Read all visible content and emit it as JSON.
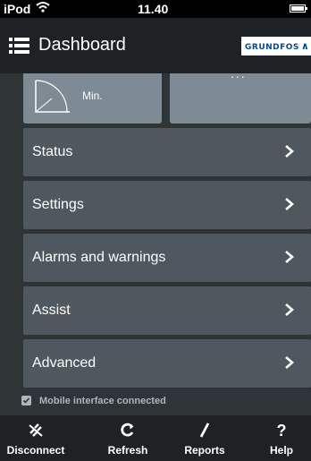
{
  "status_bar": {
    "carrier": "iPod",
    "time": "11.40"
  },
  "header": {
    "title": "Dashboard",
    "logo_text": "GRUNDFOS"
  },
  "tiles": {
    "left_label": "Min.",
    "right_text": "..."
  },
  "menu": [
    {
      "label": "Status"
    },
    {
      "label": "Settings"
    },
    {
      "label": "Alarms and warnings"
    },
    {
      "label": "Assist"
    },
    {
      "label": "Advanced"
    }
  ],
  "connection": {
    "text": "Mobile interface connected",
    "checked": true
  },
  "tabbar": {
    "items": [
      {
        "label": "Disconnect",
        "icon": "disconnect-icon"
      },
      {
        "label": "Refresh",
        "icon": "refresh-icon"
      },
      {
        "label": "Reports",
        "icon": "pencil-icon"
      },
      {
        "label": "Help",
        "icon": "help-icon"
      }
    ]
  },
  "colors": {
    "background": "#2f3437",
    "bar": "#1e2225",
    "menu_item": "#4e585e",
    "tile": "#7f8b94",
    "brand_blue": "#004a97"
  }
}
